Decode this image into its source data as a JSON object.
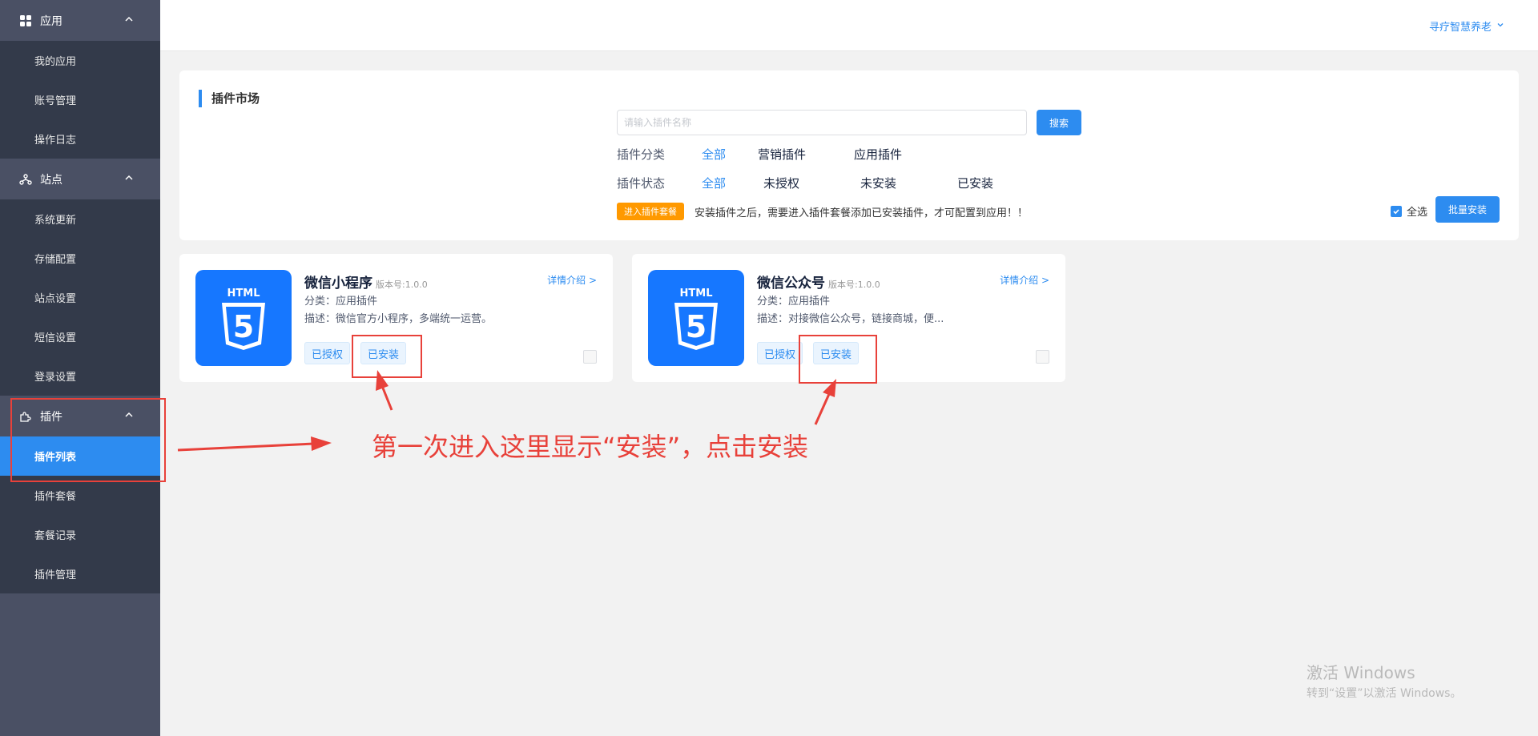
{
  "sidebar": {
    "groups": [
      {
        "title": "应用",
        "icon": "apps-grid-icon",
        "items": [
          "我的应用",
          "账号管理",
          "操作日志"
        ]
      },
      {
        "title": "站点",
        "icon": "sitemap-icon",
        "items": [
          "系统更新",
          "存储配置",
          "站点设置",
          "短信设置",
          "登录设置"
        ]
      },
      {
        "title": "插件",
        "icon": "puzzle-icon",
        "items": [
          "插件列表",
          "插件套餐",
          "套餐记录",
          "插件管理"
        ],
        "active_item": "插件列表"
      }
    ]
  },
  "header": {
    "user_menu": "寻疗智慧养老"
  },
  "market": {
    "title": "插件市场",
    "search": {
      "placeholder": "请输入插件名称",
      "value": "",
      "button": "搜索"
    },
    "category": {
      "label": "插件分类",
      "options": [
        "全部",
        "营销插件",
        "应用插件"
      ],
      "selected": "全部"
    },
    "status": {
      "label": "插件状态",
      "options": [
        "全部",
        "未授权",
        "未安装",
        "已安装"
      ],
      "selected": "全部"
    },
    "package_button": "进入插件套餐",
    "tip": "安装插件之后，需要进入插件套餐添加已安装插件，才可配置到应用！！",
    "select_all": "全选",
    "select_all_checked": true,
    "batch_install": "批量安装"
  },
  "plugins": [
    {
      "name": "微信小程序",
      "version": "版本号:1.0.0",
      "detail": "详情介绍 >",
      "category": "分类：应用插件",
      "description": "描述：微信官方小程序，多端统一运营。",
      "tags": [
        "已授权",
        "已安装"
      ],
      "logo_text": "HTML",
      "logo_digit": "5",
      "checked": false
    },
    {
      "name": "微信公众号",
      "version": "版本号:1.0.0",
      "detail": "详情介绍 >",
      "category": "分类：应用插件",
      "description": "描述：对接微信公众号，链接商城，便...",
      "tags": [
        "已授权",
        "已安装"
      ],
      "logo_text": "HTML",
      "logo_digit": "5",
      "checked": false
    }
  ],
  "annotation": {
    "text": "第一次进入这里显示“安装”，点击安装",
    "color": "#e8413a"
  },
  "watermark": {
    "title": "激活 Windows",
    "subtitle": "转到“设置”以激活 Windows。"
  },
  "colors": {
    "primary": "#2d8cf0",
    "sidebar_bg": "#4a5064",
    "sidebar_items_bg": "#333a4a",
    "warning": "#ff9900",
    "logo_bg": "#1677ff"
  }
}
